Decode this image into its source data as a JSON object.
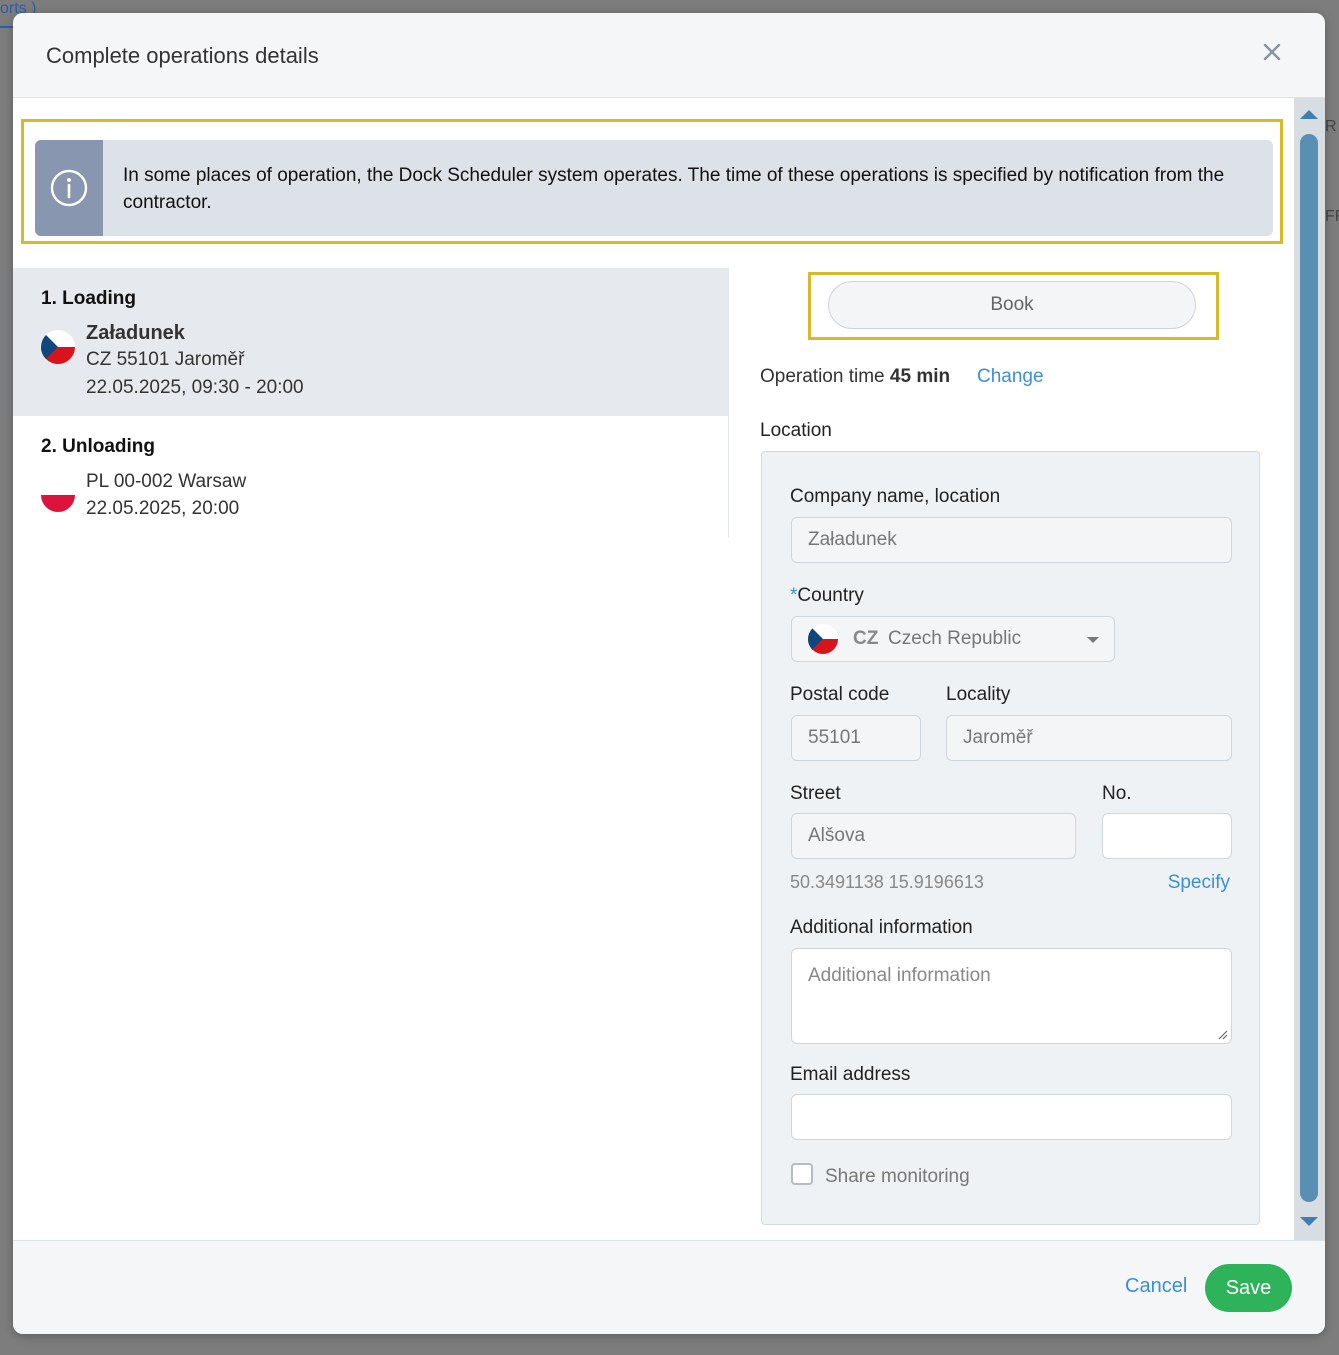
{
  "background": {
    "link_text": "orts )",
    "right_text_1": "R",
    "right_text_2": "FF"
  },
  "modal": {
    "title": "Complete operations details",
    "info_text": "In some places of operation, the Dock Scheduler system operates. The time of these operations is specified by notification from the contractor."
  },
  "operations": [
    {
      "title": "1. Loading",
      "name": "Załadunek",
      "address": "CZ 55101 Jaroměř",
      "time": "22.05.2025, 09:30 - 20:00",
      "country": "CZ"
    },
    {
      "title": "2. Unloading",
      "address": "PL 00-002 Warsaw",
      "time": "22.05.2025, 20:00",
      "country": "PL"
    }
  ],
  "right": {
    "book_label": "Book",
    "op_time_prefix": "Operation time",
    "op_time_value": "45 min",
    "change_label": "Change",
    "location_label": "Location"
  },
  "form": {
    "company_label": "Company name, location",
    "company_value": "Załadunek",
    "country_required_mark": "*",
    "country_label": "Country",
    "country_code": "CZ",
    "country_name": "Czech Republic",
    "postal_label": "Postal code",
    "postal_value": "55101",
    "locality_label": "Locality",
    "locality_value": "Jaroměř",
    "street_label": "Street",
    "street_value": "Alšova",
    "no_label": "No.",
    "no_value": "",
    "coords": "50.3491138 15.9196613",
    "specify_label": "Specify",
    "additional_label": "Additional information",
    "additional_placeholder": "Additional information",
    "email_label": "Email address",
    "email_value": "",
    "share_label": "Share monitoring",
    "share_checked": false
  },
  "footer": {
    "cancel_label": "Cancel",
    "save_label": "Save"
  },
  "colors": {
    "accent": "#3b8fd9",
    "save": "#2fb35a",
    "highlight": "#d8b92a",
    "info_icon_bg": "#8896b0"
  }
}
